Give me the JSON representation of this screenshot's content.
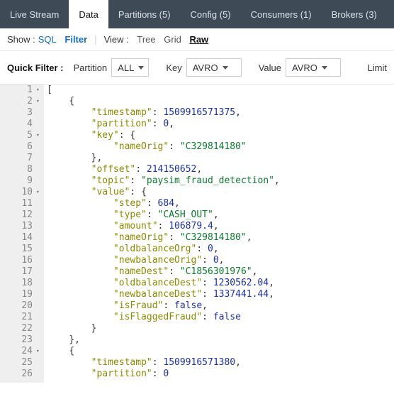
{
  "tabs": [
    {
      "label": "Live Stream"
    },
    {
      "label": "Data"
    },
    {
      "label": "Partitions (5)"
    },
    {
      "label": "Config (5)"
    },
    {
      "label": "Consumers (1)"
    },
    {
      "label": "Brokers (3)"
    }
  ],
  "active_tab": "Data",
  "showbar": {
    "show_label": "Show :",
    "sql": "SQL",
    "filter": "Filter",
    "view_label": "View :",
    "tree": "Tree",
    "grid": "Grid",
    "raw": "Raw"
  },
  "quickbar": {
    "label": "Quick Filter :",
    "partition_label": "Partition",
    "partition_value": "ALL",
    "key_label": "Key",
    "key_value": "AVRO",
    "value_label": "Value",
    "value_value": "AVRO",
    "limit_label": "Limit"
  },
  "code": {
    "start_line": 1,
    "fold_lines": [
      1,
      2,
      5,
      10,
      24
    ],
    "lines": [
      "[",
      "    {",
      "        \"timestamp\": 1509916571375,",
      "        \"partition\": 0,",
      "        \"key\": {",
      "            \"nameOrig\": \"C329814180\"",
      "        },",
      "        \"offset\": 214150652,",
      "        \"topic\": \"paysim_fraud_detection\",",
      "        \"value\": {",
      "            \"step\": 684,",
      "            \"type\": \"CASH_OUT\",",
      "            \"amount\": 106879.4,",
      "            \"nameOrig\": \"C329814180\",",
      "            \"oldbalanceOrg\": 0,",
      "            \"newbalanceOrig\": 0,",
      "            \"nameDest\": \"C1856301976\",",
      "            \"oldbalanceDest\": 1230562.04,",
      "            \"newbalanceDest\": 1337441.44,",
      "            \"isFraud\": false,",
      "            \"isFlaggedFraud\": false",
      "        }",
      "    },",
      "    {",
      "        \"timestamp\": 1509916571380,",
      "        \"partition\": 0"
    ]
  }
}
